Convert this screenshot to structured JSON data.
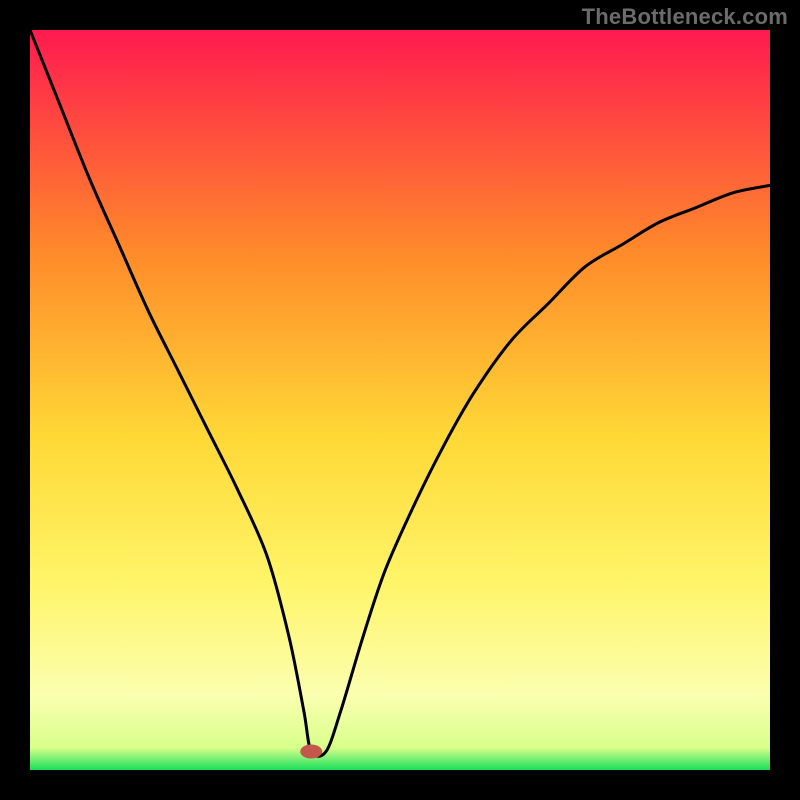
{
  "watermark": "TheBottleneck.com",
  "chart_data": {
    "type": "line",
    "title": "",
    "xlabel": "",
    "ylabel": "",
    "xlim": [
      0,
      100
    ],
    "ylim": [
      0,
      100
    ],
    "grid": false,
    "legend": false,
    "background_gradient": {
      "top": "#ff1a4f",
      "mid_upper": "#ff8a2a",
      "mid": "#ffd836",
      "mid_lower": "#fff56a",
      "band": "#fbffb0",
      "bottom": "#18e05c"
    },
    "marker": {
      "x": 38,
      "y": 2.5,
      "color": "#c4564c"
    },
    "series": [
      {
        "name": "bottleneck-curve",
        "x": [
          0,
          4,
          8,
          12,
          16,
          20,
          24,
          28,
          32,
          35,
          37,
          38,
          40,
          42,
          45,
          48,
          52,
          56,
          60,
          65,
          70,
          75,
          80,
          85,
          90,
          95,
          100
        ],
        "values": [
          100,
          90,
          80,
          71,
          62,
          54,
          46,
          38,
          29,
          18,
          8,
          2.5,
          2.5,
          8,
          18,
          27,
          36,
          44,
          51,
          58,
          63,
          68,
          71,
          74,
          76,
          78,
          79
        ]
      }
    ]
  }
}
